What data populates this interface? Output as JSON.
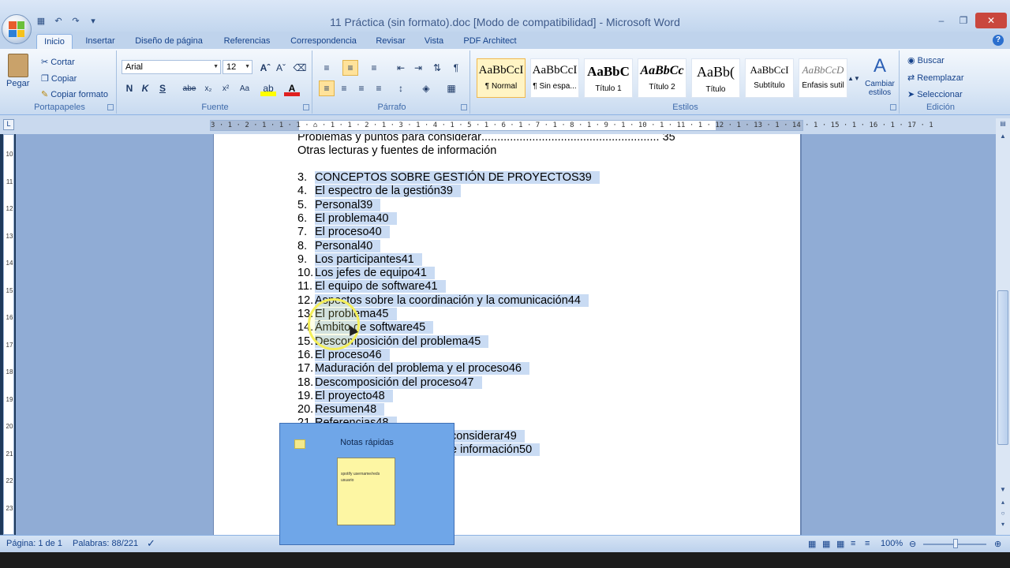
{
  "window": {
    "title": "11 Práctica (sin formato).doc [Modo de compatibilidad] - Microsoft Word"
  },
  "tabs": [
    {
      "label": "Inicio",
      "active": true
    },
    {
      "label": "Insertar"
    },
    {
      "label": "Diseño de página"
    },
    {
      "label": "Referencias"
    },
    {
      "label": "Correspondencia"
    },
    {
      "label": "Revisar"
    },
    {
      "label": "Vista"
    },
    {
      "label": "PDF Architect"
    }
  ],
  "ribbon": {
    "clipboard": {
      "label": "Portapapeles",
      "paste": "Pegar",
      "cut": "Cortar",
      "copy": "Copiar",
      "format_painter": "Copiar formato"
    },
    "font": {
      "label": "Fuente",
      "font_name": "Arial",
      "font_size": "12"
    },
    "paragraph": {
      "label": "Párrafo"
    },
    "styles": {
      "label": "Estilos",
      "items": [
        {
          "sample": "AaBbCcI",
          "name": "¶ Normal"
        },
        {
          "sample": "AaBbCcI",
          "name": "¶ Sin espa..."
        },
        {
          "sample": "AaBbC",
          "name": "Título 1"
        },
        {
          "sample": "AaBbCc",
          "name": "Título 2"
        },
        {
          "sample": "AaBb(",
          "name": "Título"
        },
        {
          "sample": "AaBbCcI",
          "name": "Subtítulo"
        },
        {
          "sample": "AaBbCcD",
          "name": "Énfasis sutil"
        }
      ],
      "change_styles": "Cambiar estilos"
    },
    "editing": {
      "label": "Edición",
      "find": "Buscar",
      "replace": "Reemplazar",
      "select": "Seleccionar"
    }
  },
  "ruler": {
    "numbers": "3 · 1 · 2 · 1 · 1 · 1 · ⌂ · 1 · 1 · 2 · 1 · 3 · 1 · 4 · 1 · 5 · 1 · 6 · 1 · 7 · 1 · 8 · 1 · 9 · 1 · 10 · 1 · 11 · 1 · 12 · 1 · 13 · 1 · 14 · 1 · 15 · 1 · 16 · 1 · 17 · 1"
  },
  "vruler_numbers": [
    "10",
    "11",
    "12",
    "13",
    "14",
    "15",
    "16",
    "17",
    "18",
    "19",
    "20",
    "21",
    "22",
    "23"
  ],
  "document": {
    "pre_lines": [
      {
        "text": "Problemas y puntos para considerar",
        "page": "35"
      },
      {
        "text": "Otras lecturas y fuentes de información"
      }
    ],
    "items": [
      {
        "num": "3.",
        "text": "CONCEPTOS SOBRE GESTIÓN DE PROYECTOS39"
      },
      {
        "num": "4.",
        "text": "El espectro de la gestión39"
      },
      {
        "num": "5.",
        "text": "Personal39"
      },
      {
        "num": "6.",
        "text": "El problema40"
      },
      {
        "num": "7.",
        "text": "El proceso40"
      },
      {
        "num": "8.",
        "text": "Personal40"
      },
      {
        "num": "9.",
        "text": "Los participantes41"
      },
      {
        "num": "10.",
        "text": "Los jefes de equipo41"
      },
      {
        "num": "11.",
        "text": "El equipo de software41"
      },
      {
        "num": "12.",
        "text": "Aspectos sobre la coordinación y la comunicación44"
      },
      {
        "num": "13.",
        "text": "El problema45"
      },
      {
        "num": "14.",
        "text": "Ámbito de software45"
      },
      {
        "num": "15.",
        "text": "Descomposición del problema45"
      },
      {
        "num": "16.",
        "text": "El proceso46"
      },
      {
        "num": "17.",
        "text": "Maduración del problema y el proceso46"
      },
      {
        "num": "18.",
        "text": "Descomposición del proceso47"
      },
      {
        "num": "19.",
        "text": "El proyecto48"
      },
      {
        "num": "20.",
        "text": "Resumen48"
      },
      {
        "num": "21.",
        "text": "Referencias48"
      }
    ],
    "partial_lines": [
      {
        "text": "considerar49"
      },
      {
        "text": "e información50"
      }
    ]
  },
  "sticky_popup": {
    "title": "Notas rápidas",
    "note_text": "spotify username/reds usuario"
  },
  "statusbar": {
    "page": "Página: 1 de 1",
    "words": "Palabras: 88/221",
    "zoom": "100%"
  },
  "colors": {
    "selection": "#c9dbf3",
    "ribbon": "#dce8f6",
    "popup": "#6fa6e8"
  }
}
